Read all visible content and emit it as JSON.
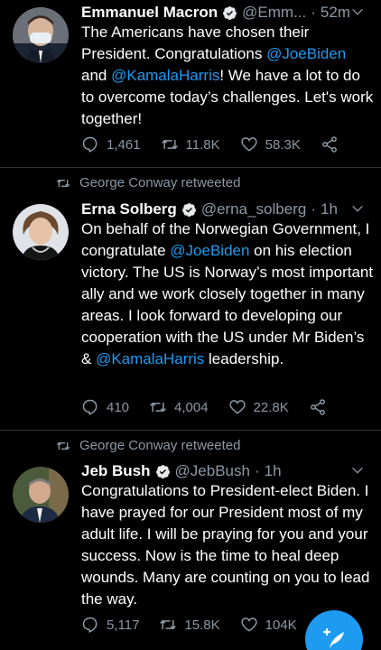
{
  "tweets": [
    {
      "retweeted_by": "",
      "name": "Emmanuel Macron",
      "handle": "@Emm...",
      "time": "52m",
      "text": {
        "t1": "The Americans have chosen their President. Congratulations ",
        "m1": "@JoeBiden",
        "t2": " and ",
        "m2": "@KamalaHarris",
        "t3": "! We have a lot to do to overcome today’s challenges. Let's work together!"
      },
      "replies": "1,461",
      "retweets": "11.8K",
      "likes": "58.3K"
    },
    {
      "retweeted_by": "George Conway retweeted",
      "name": "Erna Solberg",
      "handle": "@erna_solberg",
      "time": "1h",
      "text": {
        "t1": "On behalf of the Norwegian Government, I congratulate ",
        "m1": "@JoeBiden",
        "t2": " on his election victory. The US is Norway’s most important ally and we work closely together in many areas. I look forward to developing our cooperation with the US under Mr Biden’s & ",
        "m2": "@KamalaHarris",
        "t3": " leadership."
      },
      "replies": "410",
      "retweets": "4,004",
      "likes": "22.8K"
    },
    {
      "retweeted_by": "George Conway retweeted",
      "name": "Jeb Bush",
      "handle": "@JebBush",
      "time": "1h",
      "text": {
        "t1": "Congratulations to President-elect Biden. I have prayed for our President most of my adult life. I will be praying for you and your success. Now is the time to heal deep wounds. Many are counting on you to lead the way."
      },
      "replies": "5,117",
      "retweets": "15.8K",
      "likes": "104K"
    }
  ],
  "icons": {
    "retweet_context": "retweet-icon",
    "verified": "verified-badge-icon",
    "caret": "chevron-down-icon",
    "reply": "reply-icon",
    "retweet": "retweet-icon",
    "like": "heart-icon",
    "share": "share-icon",
    "compose": "compose-tweet-icon"
  },
  "colors": {
    "background": "#000000",
    "accent": "#1d9bf0",
    "secondary_text": "#8b98a5"
  }
}
